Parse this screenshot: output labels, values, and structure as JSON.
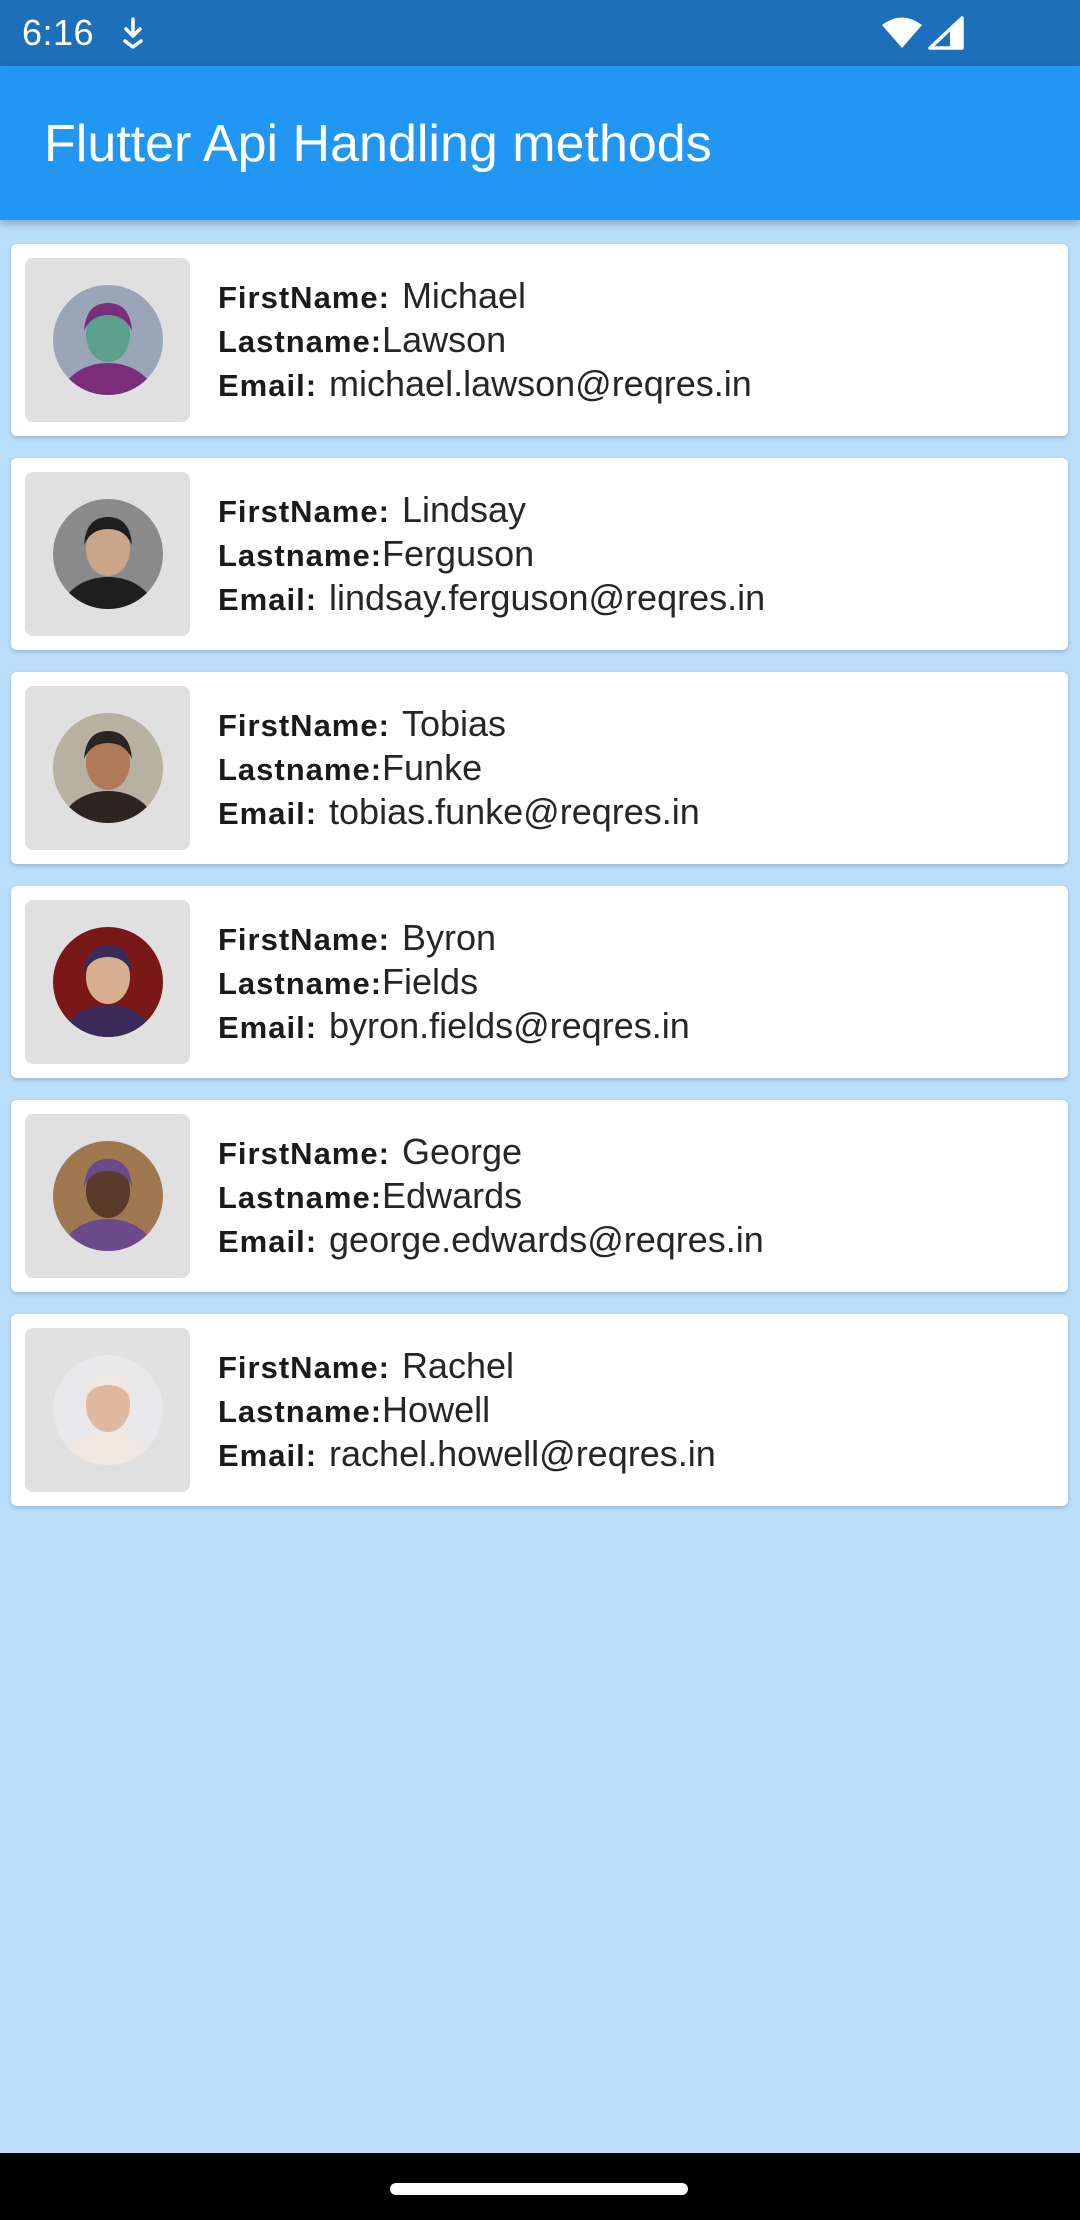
{
  "status_bar": {
    "time": "6:16",
    "icons": [
      "download-icon",
      "wifi-icon",
      "signal-icon"
    ]
  },
  "app_bar": {
    "title": "Flutter Api Handling methods",
    "color": "#2196f3"
  },
  "labels": {
    "first_name": "FirstName:",
    "last_name": "Lastname:",
    "email": "Email:"
  },
  "users": [
    {
      "first_name": "Michael",
      "last_name": "Lawson",
      "email": "michael.lawson@reqres.in",
      "avatar": {
        "bg": "#9aa6b8",
        "fg": "#7a2d7a",
        "skin": "#5aa08a"
      }
    },
    {
      "first_name": "Lindsay",
      "last_name": "Ferguson",
      "email": "lindsay.ferguson@reqres.in",
      "avatar": {
        "bg": "#8a8a8a",
        "fg": "#1e1e1e",
        "skin": "#c9a58a"
      }
    },
    {
      "first_name": "Tobias",
      "last_name": "Funke",
      "email": "tobias.funke@reqres.in",
      "avatar": {
        "bg": "#b8b0a0",
        "fg": "#2c2420",
        "skin": "#b07a5a"
      }
    },
    {
      "first_name": "Byron",
      "last_name": "Fields",
      "email": "byron.fields@reqres.in",
      "avatar": {
        "bg": "#7a1818",
        "fg": "#3a2a5a",
        "skin": "#d8b090"
      }
    },
    {
      "first_name": "George",
      "last_name": "Edwards",
      "email": "george.edwards@reqres.in",
      "avatar": {
        "bg": "#a07850",
        "fg": "#6a4a8a",
        "skin": "#5a3a2a"
      }
    },
    {
      "first_name": "Rachel",
      "last_name": "Howell",
      "email": "rachel.howell@reqres.in",
      "avatar": {
        "bg": "#e8e8ea",
        "fg": "#f0e8e0",
        "skin": "#e0b8a0"
      }
    }
  ],
  "background_color": "#bbdefb"
}
